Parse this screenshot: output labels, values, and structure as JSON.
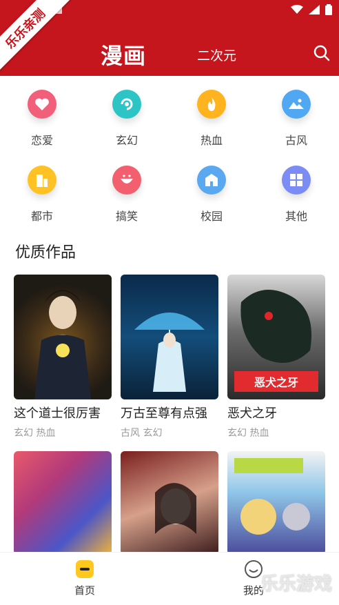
{
  "brand_ribbon": "乐乐亲测",
  "header": {
    "title": "漫画",
    "secondary_tab": "二次元"
  },
  "categories": [
    {
      "label": "恋爱",
      "icon": "heart-icon",
      "color": "#f25f7a"
    },
    {
      "label": "玄幻",
      "icon": "swirl-icon",
      "color": "#2cc4c4"
    },
    {
      "label": "热血",
      "icon": "flame-icon",
      "color": "#ffb41f"
    },
    {
      "label": "古风",
      "icon": "landscape-icon",
      "color": "#51a8f2"
    },
    {
      "label": "都市",
      "icon": "city-icon",
      "color": "#ffc224"
    },
    {
      "label": "搞笑",
      "icon": "smile-icon",
      "color": "#f25f6e"
    },
    {
      "label": "校园",
      "icon": "school-icon",
      "color": "#5aa9f0"
    },
    {
      "label": "其他",
      "icon": "grid-icon",
      "color": "#7b8cf5"
    }
  ],
  "section": {
    "title": "优质作品"
  },
  "comics": [
    {
      "title": "这个道士很厉害",
      "tags": "玄幻 热血"
    },
    {
      "title": "万古至尊有点强",
      "tags": "古风 玄幻"
    },
    {
      "title": "恶犬之牙",
      "tags": "玄幻 热血"
    },
    {
      "title": "",
      "tags": ""
    },
    {
      "title": "",
      "tags": ""
    },
    {
      "title": "",
      "tags": ""
    }
  ],
  "bottom_nav": [
    {
      "label": "首页",
      "icon": "home-icon",
      "active": true
    },
    {
      "label": "我的",
      "icon": "profile-icon",
      "active": false
    }
  ],
  "watermark": "乐乐游戏",
  "colors": {
    "primary": "#c4161c",
    "text": "#222222",
    "muted": "#999999"
  }
}
